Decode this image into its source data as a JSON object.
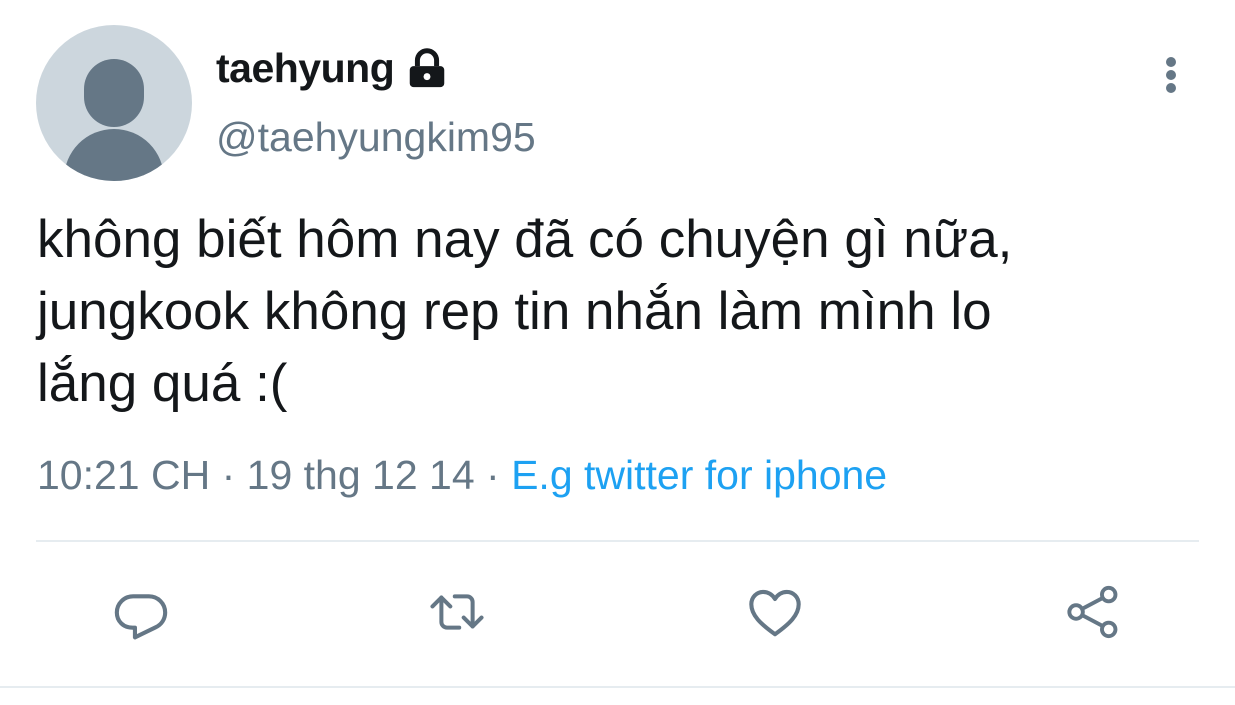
{
  "tweet": {
    "display_name": "taehyung",
    "handle": "@taehyungkim95",
    "text": "không biết hôm nay đã có chuyện gì nữa,\njungkook không rep tin nhắn làm mình lo\nlắng quá :(",
    "time": "10:21 CH",
    "date": "19 thg 12 14",
    "separator": " · ",
    "source": "E.g twitter for iphone"
  },
  "icons": {
    "avatar": "default-avatar-icon",
    "lock": "lock-icon",
    "more": "more-vertical-icon",
    "reply": "reply-icon",
    "retweet": "retweet-icon",
    "like": "heart-icon",
    "share": "share-icon"
  },
  "colors": {
    "text": "#14171a",
    "secondary": "#657786",
    "link": "#1da1f2",
    "divider": "#e6ecf0",
    "avatar_bg": "#ccd6dd"
  }
}
